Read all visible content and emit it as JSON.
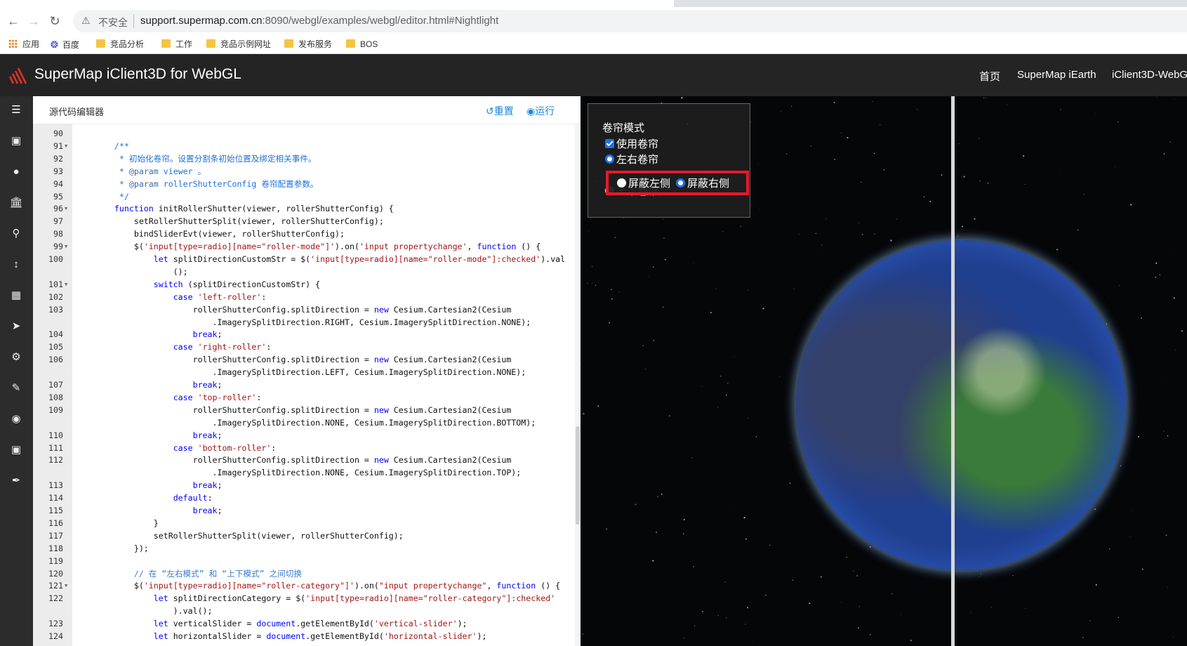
{
  "browser": {
    "insecure_label": "不安全",
    "url_host": "support.supermap.com.cn",
    "url_rest": ":8090/webgl/examples/webgl/editor.html#Nightlight",
    "bookmarks": [
      "应用",
      "百度",
      "竞品分析",
      "工作",
      "竞品示例网址",
      "发布服务",
      "BOS"
    ]
  },
  "app": {
    "title": "SuperMap iClient3D for WebGL",
    "nav": [
      "首页",
      "SuperMap iEarth",
      "iClient3D-WebG"
    ]
  },
  "sidebar_icons": [
    "layers-icon",
    "image-icon",
    "globe-icon",
    "bank-icon",
    "search-icon",
    "arrows-vertical-icon",
    "map-icon",
    "send-icon",
    "cubes-icon",
    "edit-icon",
    "eye-icon",
    "cube-icon",
    "pencil-icon"
  ],
  "editor": {
    "title": "源代码编辑器",
    "reset_label": "重置",
    "run_label": "运行",
    "lines": [
      {
        "n": "90",
        "f": false,
        "h": ""
      },
      {
        "n": "91",
        "f": true,
        "h": "    <span class=\"cm\">/**</span>"
      },
      {
        "n": "92",
        "f": false,
        "h": "     <span class=\"cm\">* 初始化卷帘。设置分割条初始位置及绑定相关事件。</span>"
      },
      {
        "n": "93",
        "f": false,
        "h": "     <span class=\"cm\">* <span class=\"pl\">@param</span> viewer 。</span>"
      },
      {
        "n": "94",
        "f": false,
        "h": "     <span class=\"cm\">* <span class=\"pl\">@param</span> rollerShutterConfig 卷帘配置参数。</span>"
      },
      {
        "n": "95",
        "f": false,
        "h": "     <span class=\"cm\">*/</span>"
      },
      {
        "n": "96",
        "f": true,
        "h": "    <span class=\"kw\">function</span> initRollerShutter(viewer, rollerShutterConfig) {"
      },
      {
        "n": "97",
        "f": false,
        "h": "        setRollerShutterSplit(viewer, rollerShutterConfig);"
      },
      {
        "n": "98",
        "f": false,
        "h": "        bindSliderEvt(viewer, rollerShutterConfig);"
      },
      {
        "n": "99",
        "f": true,
        "h": "        $(<span class=\"str\">'input[type=radio][name=\"roller-mode\"]'</span>).on(<span class=\"str\">'input propertychange'</span>, <span class=\"kw\">function</span> () {"
      },
      {
        "n": "100",
        "f": false,
        "h": "            <span class=\"kw\">let</span> splitDirectionCustomStr = $(<span class=\"str\">'input[type=radio][name=\"roller-mode\"]:checked'</span>).val"
      },
      {
        "n": "",
        "f": false,
        "h": "                ();"
      },
      {
        "n": "101",
        "f": true,
        "h": "            <span class=\"kw\">switch</span> (splitDirectionCustomStr) {"
      },
      {
        "n": "102",
        "f": false,
        "h": "                <span class=\"kw\">case</span> <span class=\"str\">'left-roller'</span>:"
      },
      {
        "n": "103",
        "f": false,
        "h": "                    rollerShutterConfig.splitDirection = <span class=\"kw\">new</span> Cesium.Cartesian2(Cesium"
      },
      {
        "n": "",
        "f": false,
        "h": "                        .ImagerySplitDirection.RIGHT, Cesium.ImagerySplitDirection.NONE);"
      },
      {
        "n": "104",
        "f": false,
        "h": "                    <span class=\"kw\">break</span>;"
      },
      {
        "n": "105",
        "f": false,
        "h": "                <span class=\"kw\">case</span> <span class=\"str\">'right-roller'</span>:"
      },
      {
        "n": "106",
        "f": false,
        "h": "                    rollerShutterConfig.splitDirection = <span class=\"kw\">new</span> Cesium.Cartesian2(Cesium"
      },
      {
        "n": "",
        "f": false,
        "h": "                        .ImagerySplitDirection.LEFT, Cesium.ImagerySplitDirection.NONE);"
      },
      {
        "n": "107",
        "f": false,
        "h": "                    <span class=\"kw\">break</span>;"
      },
      {
        "n": "108",
        "f": false,
        "h": "                <span class=\"kw\">case</span> <span class=\"str\">'top-roller'</span>:"
      },
      {
        "n": "109",
        "f": false,
        "h": "                    rollerShutterConfig.splitDirection = <span class=\"kw\">new</span> Cesium.Cartesian2(Cesium"
      },
      {
        "n": "",
        "f": false,
        "h": "                        .ImagerySplitDirection.NONE, Cesium.ImagerySplitDirection.BOTTOM);"
      },
      {
        "n": "110",
        "f": false,
        "h": "                    <span class=\"kw\">break</span>;"
      },
      {
        "n": "111",
        "f": false,
        "h": "                <span class=\"kw\">case</span> <span class=\"str\">'bottom-roller'</span>:"
      },
      {
        "n": "112",
        "f": false,
        "h": "                    rollerShutterConfig.splitDirection = <span class=\"kw\">new</span> Cesium.Cartesian2(Cesium"
      },
      {
        "n": "",
        "f": false,
        "h": "                        .ImagerySplitDirection.NONE, Cesium.ImagerySplitDirection.TOP);"
      },
      {
        "n": "113",
        "f": false,
        "h": "                    <span class=\"kw\">break</span>;"
      },
      {
        "n": "114",
        "f": false,
        "h": "                <span class=\"kw\">default</span>:"
      },
      {
        "n": "115",
        "f": false,
        "h": "                    <span class=\"kw\">break</span>;"
      },
      {
        "n": "116",
        "f": false,
        "h": "            }"
      },
      {
        "n": "117",
        "f": false,
        "h": "            setRollerShutterSplit(viewer, rollerShutterConfig);"
      },
      {
        "n": "118",
        "f": false,
        "h": "        });"
      },
      {
        "n": "119",
        "f": false,
        "h": ""
      },
      {
        "n": "120",
        "f": false,
        "h": "        <span class=\"cmj\">// 在 “左右模式” 和 “上下模式” 之间切换</span>"
      },
      {
        "n": "121",
        "f": true,
        "h": "        $(<span class=\"str\">'input[type=radio][name=\"roller-category\"]'</span>).on(<span class=\"str\">\"input propertychange\"</span>, <span class=\"kw\">function</span> () {"
      },
      {
        "n": "122",
        "f": false,
        "h": "            <span class=\"kw\">let</span> splitDirectionCategory = $(<span class=\"str\">'input[type=radio][name=\"roller-category\"]:checked'</span>"
      },
      {
        "n": "",
        "f": false,
        "h": "                ).val();"
      },
      {
        "n": "123",
        "f": false,
        "h": "            <span class=\"kw\">let</span> verticalSlider = <span class=\"kw\">document</span>.getElementById(<span class=\"str\">'vertical-slider'</span>);"
      },
      {
        "n": "124",
        "f": false,
        "h": "            <span class=\"kw\">let</span> horizontalSlider = <span class=\"kw\">document</span>.getElementById(<span class=\"str\">'horizontal-slider'</span>);"
      }
    ]
  },
  "panel": {
    "title": "卷帘模式",
    "use_roller": "使用卷帘",
    "left_right": "左右卷帘",
    "hide_left": "屏蔽左侧",
    "hide_right": "屏蔽右侧",
    "top_bottom": "上下卷帘"
  },
  "colors": {
    "accent": "#1c86de",
    "highlight": "#e8182a",
    "appbar": "#242424"
  }
}
